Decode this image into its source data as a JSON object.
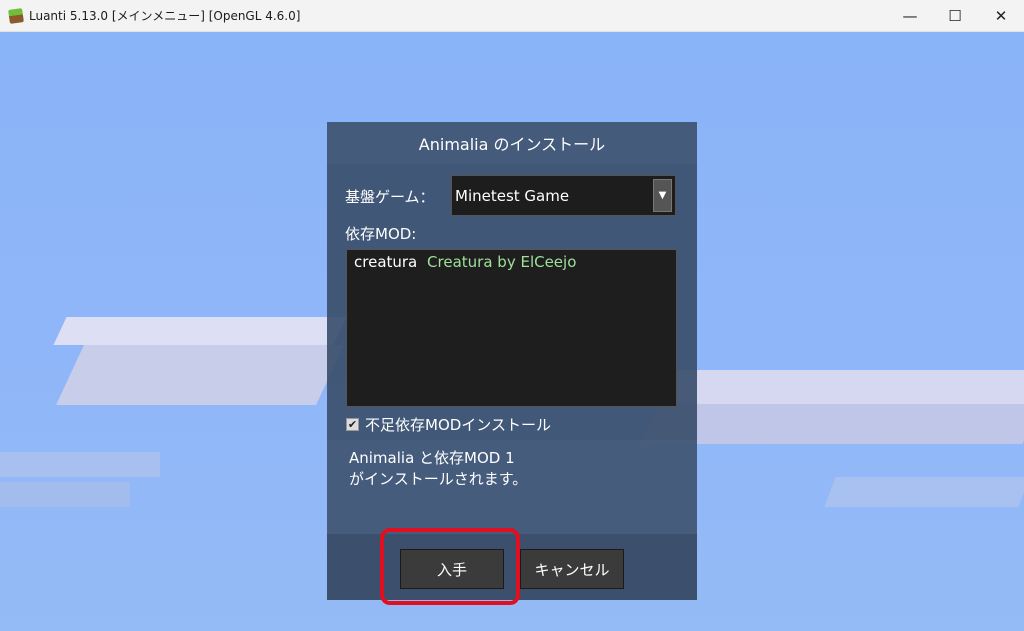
{
  "window": {
    "title": "Luanti 5.13.0 [メインメニュー] [OpenGL 4.6.0]",
    "minimize_glyph": "—",
    "maximize_glyph": "☐",
    "close_glyph": "✕"
  },
  "dialog": {
    "title": "Animalia のインストール",
    "base_game_label": "基盤ゲーム：",
    "base_game_value": "Minetest Game",
    "dependencies_label": "依存MOD:",
    "dependencies": [
      {
        "name": "creatura",
        "title": "Creatura by ElCeejo"
      }
    ],
    "install_missing_label": "不足依存MODインストール",
    "install_missing_checked": true,
    "info_line1": "Animalia と依存MOD 1",
    "info_line2": "がインストールされます。",
    "install_button": "入手",
    "cancel_button": "キャンセル"
  },
  "colors": {
    "dep_title": "#9fe09a",
    "highlight": "#e01020"
  }
}
